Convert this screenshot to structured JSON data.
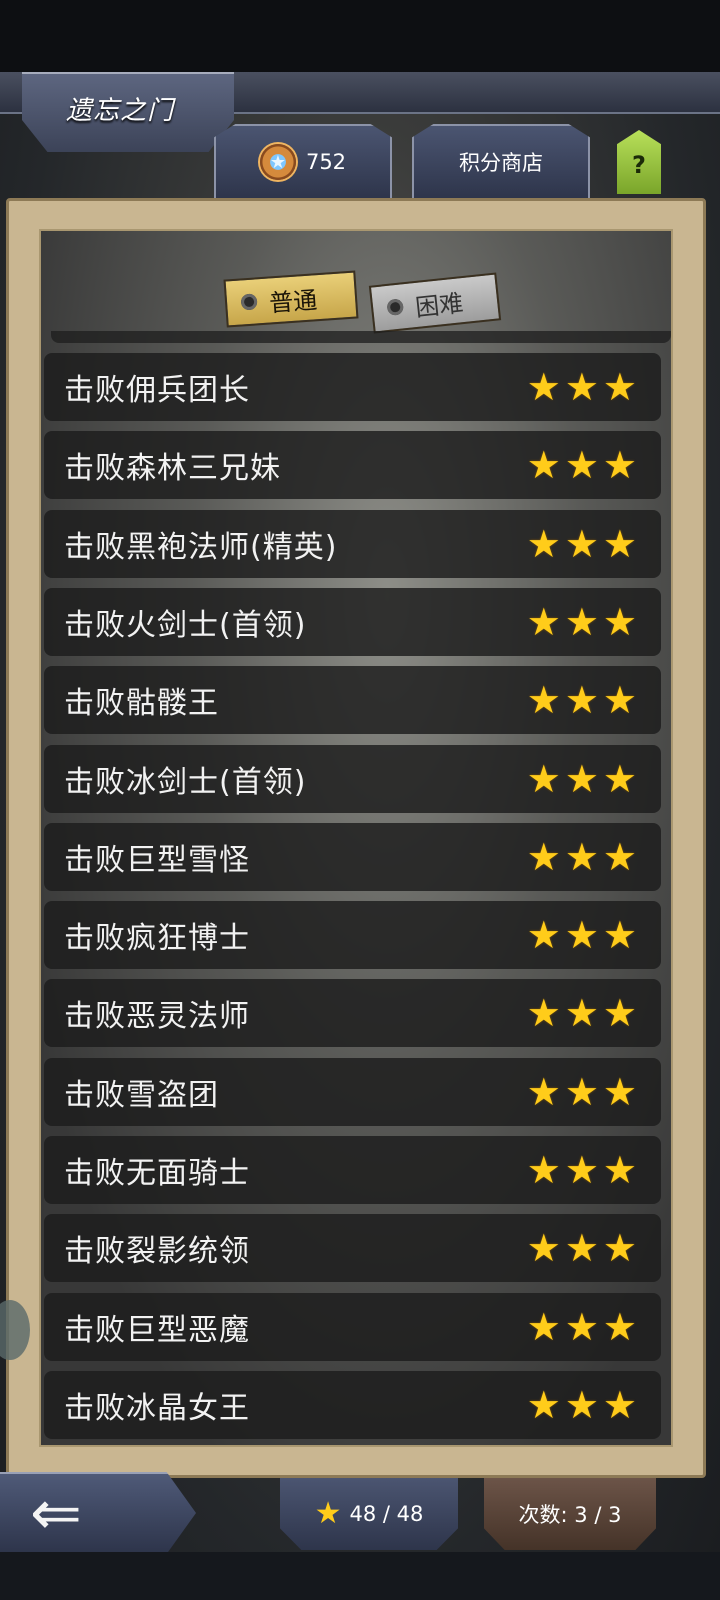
{
  "header": {
    "title": "遗忘之门",
    "points": "752",
    "shop_label": "积分商店",
    "help_label": "?"
  },
  "modes": {
    "normal": "普通",
    "hard": "困难",
    "selected": "普通"
  },
  "stages": [
    {
      "label": "击败佣兵团长",
      "stars": 3
    },
    {
      "label": "击败森林三兄妹",
      "stars": 3
    },
    {
      "label": "击败黑袍法师(精英)",
      "stars": 3
    },
    {
      "label": "击败火剑士(首领)",
      "stars": 3
    },
    {
      "label": "击败骷髅王",
      "stars": 3
    },
    {
      "label": "击败冰剑士(首领)",
      "stars": 3
    },
    {
      "label": "击败巨型雪怪",
      "stars": 3
    },
    {
      "label": "击败疯狂博士",
      "stars": 3
    },
    {
      "label": "击败恶灵法师",
      "stars": 3
    },
    {
      "label": "击败雪盗团",
      "stars": 3
    },
    {
      "label": "击败无面骑士",
      "stars": 3
    },
    {
      "label": "击败裂影统领",
      "stars": 3
    },
    {
      "label": "击败巨型恶魔",
      "stars": 3
    },
    {
      "label": "击败冰晶女王",
      "stars": 3
    }
  ],
  "footer": {
    "star_total": "48 / 48",
    "attempts": "次数: 3 / 3"
  },
  "colors": {
    "star": "#ffcc1a",
    "frame": "#c9b691",
    "row_bg": "#1c1c1c",
    "help": "#9ccb3f"
  },
  "icons": {
    "points": "medal-icon",
    "back": "back-arrow-icon",
    "star": "star-icon"
  }
}
